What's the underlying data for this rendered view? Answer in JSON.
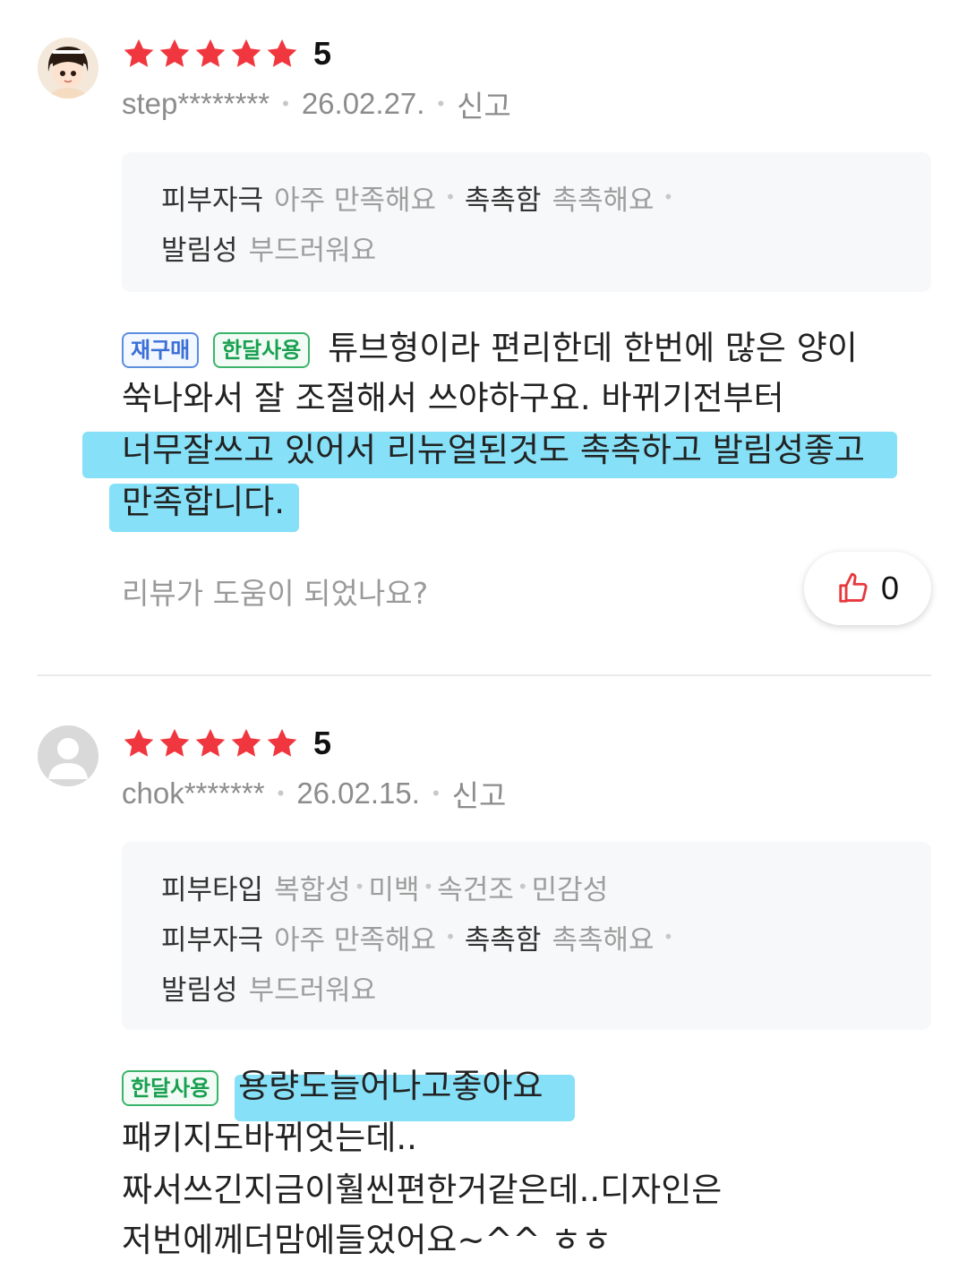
{
  "reviews": [
    {
      "rating": "5",
      "username": "step********",
      "date": "26.02.27.",
      "report_label": "신고",
      "attributes": {
        "skin_irritation_key": "피부자극",
        "skin_irritation_val": "아주 만족해요",
        "moisture_key": "촉촉함",
        "moisture_val": "촉촉해요",
        "spread_key": "발림성",
        "spread_val": "부드러워요"
      },
      "badges": [
        "재구매",
        "한달사용"
      ],
      "lines": [
        "튜브형이라 편리한데 한번에 많은 양이",
        "쑥나와서 잘 조절해서 쓰야하구요. 바뀌기전부터",
        "너무잘쓰고 있어서 리뉴얼된것도 촉촉하고 발림성좋고",
        "만족합니다."
      ],
      "helpful_question": "리뷰가 도움이 되었나요?",
      "like_count": "0"
    },
    {
      "rating": "5",
      "username": "chok*******",
      "date": "26.02.15.",
      "report_label": "신고",
      "attributes": {
        "skin_type_key": "피부타입",
        "skin_types": [
          "복합성",
          "미백",
          "속건조",
          "민감성"
        ],
        "skin_irritation_key": "피부자극",
        "skin_irritation_val": "아주 만족해요",
        "moisture_key": "촉촉함",
        "moisture_val": "촉촉해요",
        "spread_key": "발림성",
        "spread_val": "부드러워요"
      },
      "badges": [
        "한달사용"
      ],
      "lines": [
        "용량도늘어나고좋아요",
        "패키지도바뀌엇는데..",
        "짜서쓰긴지금이훨씬편한거같은데..디자인은",
        "저번에께더맘에들었어요~^^  ㅎㅎ"
      ]
    }
  ],
  "colors": {
    "star": "#f0373f",
    "highlight": "#58d4f4",
    "thumb": "#e8383d"
  },
  "icons": {
    "star": "star-icon",
    "thumb": "thumbs-up-icon",
    "avatar1": "cartoon-girl-avatar",
    "avatar2": "default-user-avatar"
  }
}
